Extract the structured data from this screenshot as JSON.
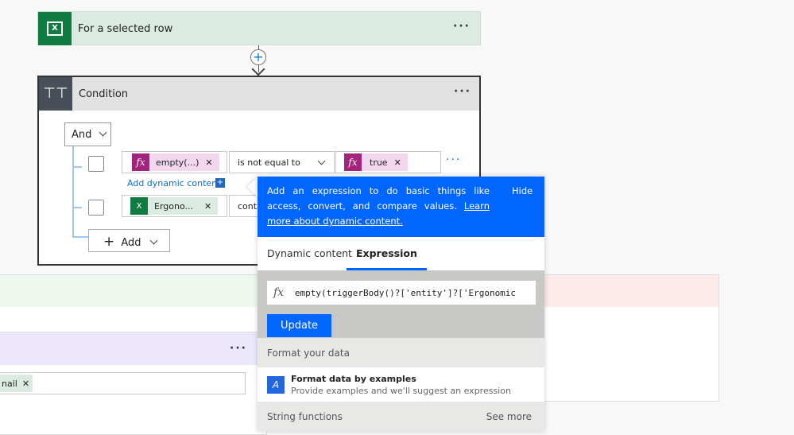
{
  "trigger": {
    "title": "For a selected row",
    "icon": "excel-icon"
  },
  "condition": {
    "title": "Condition",
    "icon": "condition-icon",
    "group_operator": "And",
    "rows": [
      {
        "left_token": "empty(...)",
        "left_icon": "fx-icon",
        "operator": "is not equal to",
        "right_token": "true",
        "right_icon": "fx-icon"
      },
      {
        "left_token": "Ergono...",
        "left_icon": "excel-icon",
        "operator": "conta"
      }
    ],
    "add_dynamic_content": "Add dynamic content",
    "add_label": "Add"
  },
  "popup": {
    "info": "Add an expression to do basic things like access, convert, and compare values.",
    "learn_more": "Learn more about dynamic content.",
    "hide": "Hide",
    "tabs": [
      {
        "label": "Dynamic content",
        "active": false
      },
      {
        "label": "Expression",
        "active": true
      }
    ],
    "expression_value": "empty(triggerBody()?['entity']?['Ergonomic",
    "update": "Update",
    "section1": "Format your data",
    "item_title": "Format data by examples",
    "item_desc": "Provide examples and we'll suggest an expression",
    "section2": "String functions",
    "see_more": "See more"
  },
  "background": {
    "token": "nail"
  },
  "colors": {
    "accent": "#0066ff",
    "excel": "#107c41",
    "fx": "#a4237d"
  }
}
